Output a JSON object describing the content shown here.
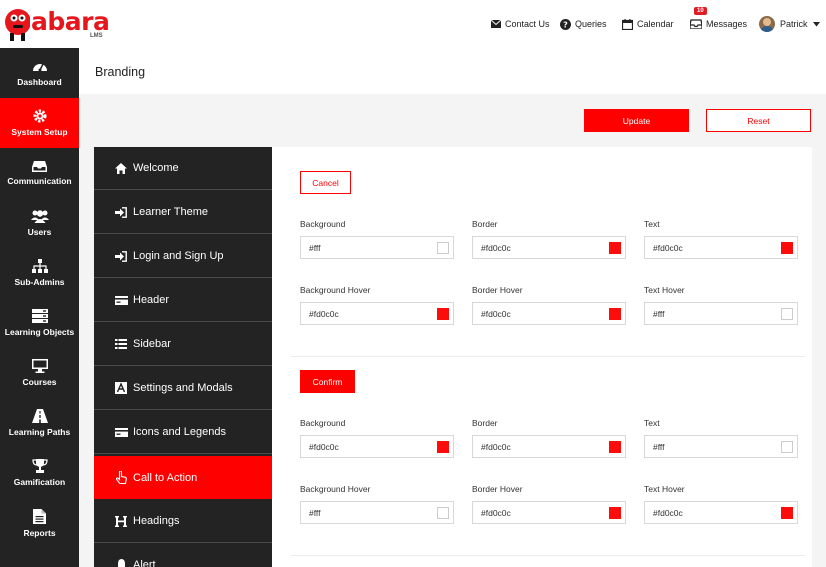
{
  "app": {
    "logo_text": "abara",
    "logo_sub": "LMS"
  },
  "top_nav": {
    "contact": "Contact Us",
    "queries": "Queries",
    "calendar": "Calendar",
    "messages": "Messages",
    "messages_count": "10",
    "user": "Patrick"
  },
  "sidebar": {
    "items": [
      {
        "label": "Dashboard",
        "icon": "dashboard-icon"
      },
      {
        "label": "System Setup",
        "icon": "gear-icon"
      },
      {
        "label": "Communication",
        "icon": "inbox-icon"
      },
      {
        "label": "Users",
        "icon": "users-icon"
      },
      {
        "label": "Sub-Admins",
        "icon": "sitemap-icon"
      },
      {
        "label": "Learning Objects",
        "icon": "server-icon"
      },
      {
        "label": "Courses",
        "icon": "monitor-icon"
      },
      {
        "label": "Learning Paths",
        "icon": "road-icon"
      },
      {
        "label": "Gamification",
        "icon": "trophy-icon"
      },
      {
        "label": "Reports",
        "icon": "file-icon"
      }
    ],
    "active_index": 1
  },
  "page": {
    "title": "Branding",
    "update_label": "Update",
    "reset_label": "Reset"
  },
  "menu": {
    "items": [
      {
        "label": "Welcome",
        "icon": "home-icon"
      },
      {
        "label": "Learner Theme",
        "icon": "sign-in-icon"
      },
      {
        "label": "Login and Sign Up",
        "icon": "sign-in-icon"
      },
      {
        "label": "Header",
        "icon": "card-icon"
      },
      {
        "label": "Sidebar",
        "icon": "list-icon"
      },
      {
        "label": "Settings and Modals",
        "icon": "font-icon"
      },
      {
        "label": "Icons and Legends",
        "icon": "card-icon"
      },
      {
        "label": "Call to Action",
        "icon": "pointer-icon"
      },
      {
        "label": "Headings",
        "icon": "heading-icon"
      },
      {
        "label": "Alert",
        "icon": "bell-icon"
      }
    ],
    "active_index": 7
  },
  "cancel_section": {
    "button_label": "Cancel",
    "fields": [
      {
        "label": "Background",
        "value": "#fff",
        "swatch": "#ffffff"
      },
      {
        "label": "Border",
        "value": "#fd0c0c",
        "swatch": "#fd0c0c"
      },
      {
        "label": "Text",
        "value": "#fd0c0c",
        "swatch": "#fd0c0c"
      },
      {
        "label": "Background Hover",
        "value": "#fd0c0c",
        "swatch": "#fd0c0c"
      },
      {
        "label": "Border Hover",
        "value": "#fd0c0c",
        "swatch": "#fd0c0c"
      },
      {
        "label": "Text Hover",
        "value": "#fff",
        "swatch": "#ffffff"
      }
    ]
  },
  "confirm_section": {
    "button_label": "Confirm",
    "fields": [
      {
        "label": "Background",
        "value": "#fd0c0c",
        "swatch": "#fd0c0c"
      },
      {
        "label": "Border",
        "value": "#fd0c0c",
        "swatch": "#fd0c0c"
      },
      {
        "label": "Text",
        "value": "#fff",
        "swatch": "#ffffff"
      },
      {
        "label": "Background Hover",
        "value": "#fff",
        "swatch": "#ffffff"
      },
      {
        "label": "Border Hover",
        "value": "#fd0c0c",
        "swatch": "#fd0c0c"
      },
      {
        "label": "Text Hover",
        "value": "#fd0c0c",
        "swatch": "#fd0c0c"
      }
    ]
  },
  "colors": {
    "accent": "#ff0000",
    "sidebar_bg": "#232323"
  }
}
